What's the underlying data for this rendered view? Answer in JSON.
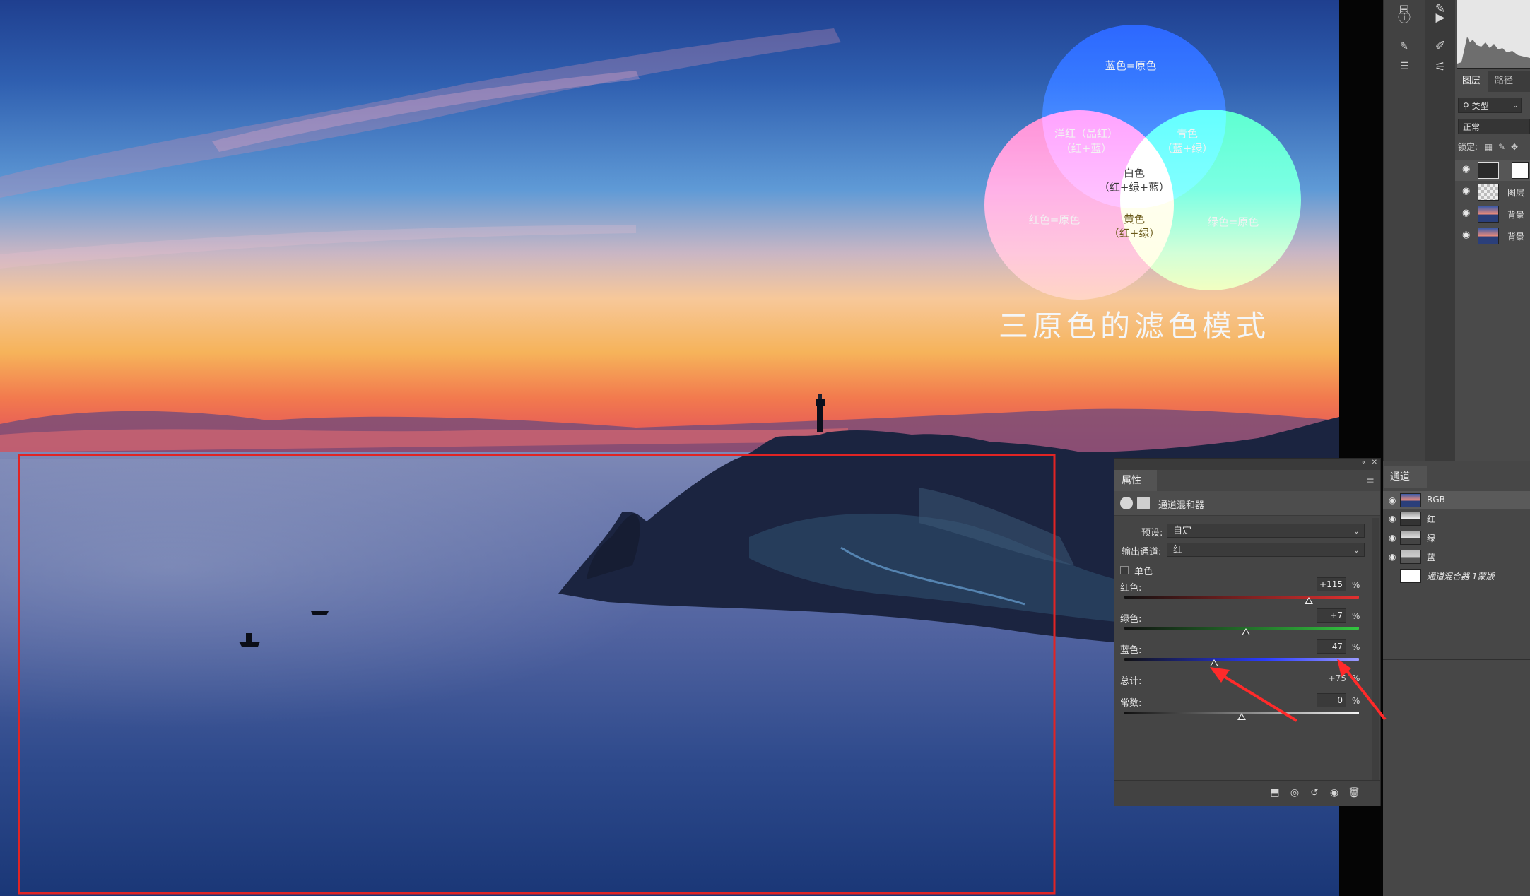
{
  "venn": {
    "blue": "蓝色=原色",
    "red": "红色=原色",
    "green": "绿色=原色",
    "magenta_1": "洋红（品红）",
    "magenta_2": "（红+蓝）",
    "cyan_1": "青色",
    "cyan_2": "（蓝+绿）",
    "white_1": "白色",
    "white_2": "（红+绿+蓝）",
    "yellow_1": "黄色",
    "yellow_2": "（红+绿）",
    "title": "三原色的滤色模式"
  },
  "layers_panel": {
    "tabs": [
      "图层",
      "路径"
    ],
    "filter_kind": "类型",
    "blend_mode": "正常",
    "lock_label": "锁定:",
    "layers": [
      {
        "name": ""
      },
      {
        "name": "图层"
      },
      {
        "name": "背景"
      },
      {
        "name": "背景"
      }
    ]
  },
  "channels_panel": {
    "tab": "通道",
    "channels": [
      {
        "name": "RGB"
      },
      {
        "name": "红"
      },
      {
        "name": "绿"
      },
      {
        "name": "蓝"
      },
      {
        "name": "通道混合器 1蒙版"
      }
    ]
  },
  "properties_panel": {
    "tab": "属性",
    "adjustment_title": "通道混和器",
    "preset_label": "预设:",
    "preset_value": "自定",
    "output_label": "输出通道:",
    "output_value": "红",
    "monochrome_label": "单色",
    "sliders": [
      {
        "label": "红色:",
        "value": "+115",
        "unit": "%",
        "level": 0.787
      },
      {
        "label": "绿色:",
        "value": "+7",
        "unit": "%",
        "level": 0.517
      },
      {
        "label": "蓝色:",
        "value": "-47",
        "unit": "%",
        "level": 0.382
      }
    ],
    "total_label": "总计:",
    "total_value": "+75",
    "total_unit": "%",
    "constant": {
      "label": "常数:",
      "value": "0",
      "unit": "%",
      "level": 0.5
    }
  },
  "colors": {
    "selection_box": "#e02424",
    "annotation_arrow": "#ff2a2a",
    "venn_blue": "#0a2bff",
    "venn_red": "#ff3b6b",
    "venn_green": "#2dff55"
  }
}
